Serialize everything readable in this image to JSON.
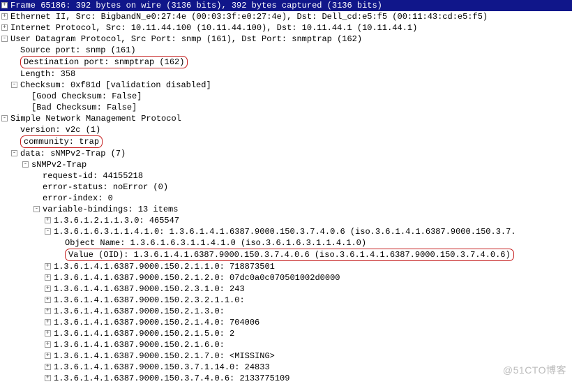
{
  "frame": "Frame 65186: 392 bytes on wire (3136 bits), 392 bytes captured (3136 bits)",
  "eth": "Ethernet II, Src: BigbandN_e0:27:4e (00:03:3f:e0:27:4e), Dst: Dell_cd:e5:f5 (00:11:43:cd:e5:f5)",
  "ip": "Internet Protocol, Src: 10.11.44.100 (10.11.44.100), Dst: 10.11.44.1 (10.11.44.1)",
  "udp": {
    "title": "User Datagram Protocol, Src Port: snmp (161), Dst Port: snmptrap (162)",
    "src": "Source port: snmp (161)",
    "dst": "Destination port: snmptrap (162)",
    "len": "Length: 358",
    "chk": "Checksum: 0xf81d [validation disabled]",
    "good": "[Good Checksum: False]",
    "bad": "[Bad Checksum: False]"
  },
  "snmp": {
    "title": "Simple Network Management Protocol",
    "ver": "version: v2c (1)",
    "comm": "community: trap",
    "data": "data: sNMPv2-Trap (7)",
    "trap": "sNMPv2-Trap",
    "req": "request-id: 44155218",
    "err": "error-status: noError (0)",
    "eidx": "error-index: 0",
    "vb": "variable-bindings: 13 items",
    "items": {
      "v1": "1.3.6.1.2.1.1.3.0: 465547",
      "v2": "1.3.6.1.6.3.1.1.4.1.0: 1.3.6.1.4.1.6387.9000.150.3.7.4.0.6 (iso.3.6.1.4.1.6387.9000.150.3.7.",
      "v2a": "Object Name: 1.3.6.1.6.3.1.1.4.1.0 (iso.3.6.1.6.3.1.1.4.1.0)",
      "v2b": "Value (OID): 1.3.6.1.4.1.6387.9000.150.3.7.4.0.6 (iso.3.6.1.4.1.6387.9000.150.3.7.4.0.6)",
      "v3": "1.3.6.1.4.1.6387.9000.150.2.1.1.0: 718873501",
      "v4": "1.3.6.1.4.1.6387.9000.150.2.1.2.0: 07dc0a0c070501002d0000",
      "v5": "1.3.6.1.4.1.6387.9000.150.2.3.1.0: 243",
      "v6": "1.3.6.1.4.1.6387.9000.150.2.3.2.1.1.0:",
      "v7": "1.3.6.1.4.1.6387.9000.150.2.1.3.0:",
      "v8": "1.3.6.1.4.1.6387.9000.150.2.1.4.0: 704006",
      "v9": "1.3.6.1.4.1.6387.9000.150.2.1.5.0: 2",
      "v10": "1.3.6.1.4.1.6387.9000.150.2.1.6.0:",
      "v11": "1.3.6.1.4.1.6387.9000.150.2.1.7.0: <MISSING>",
      "v12": "1.3.6.1.4.1.6387.9000.150.3.7.1.14.0: 24833",
      "v13": "1.3.6.1.4.1.6387.9000.150.3.7.4.0.6: 2133775109"
    }
  },
  "watermark": "@51CTO博客"
}
